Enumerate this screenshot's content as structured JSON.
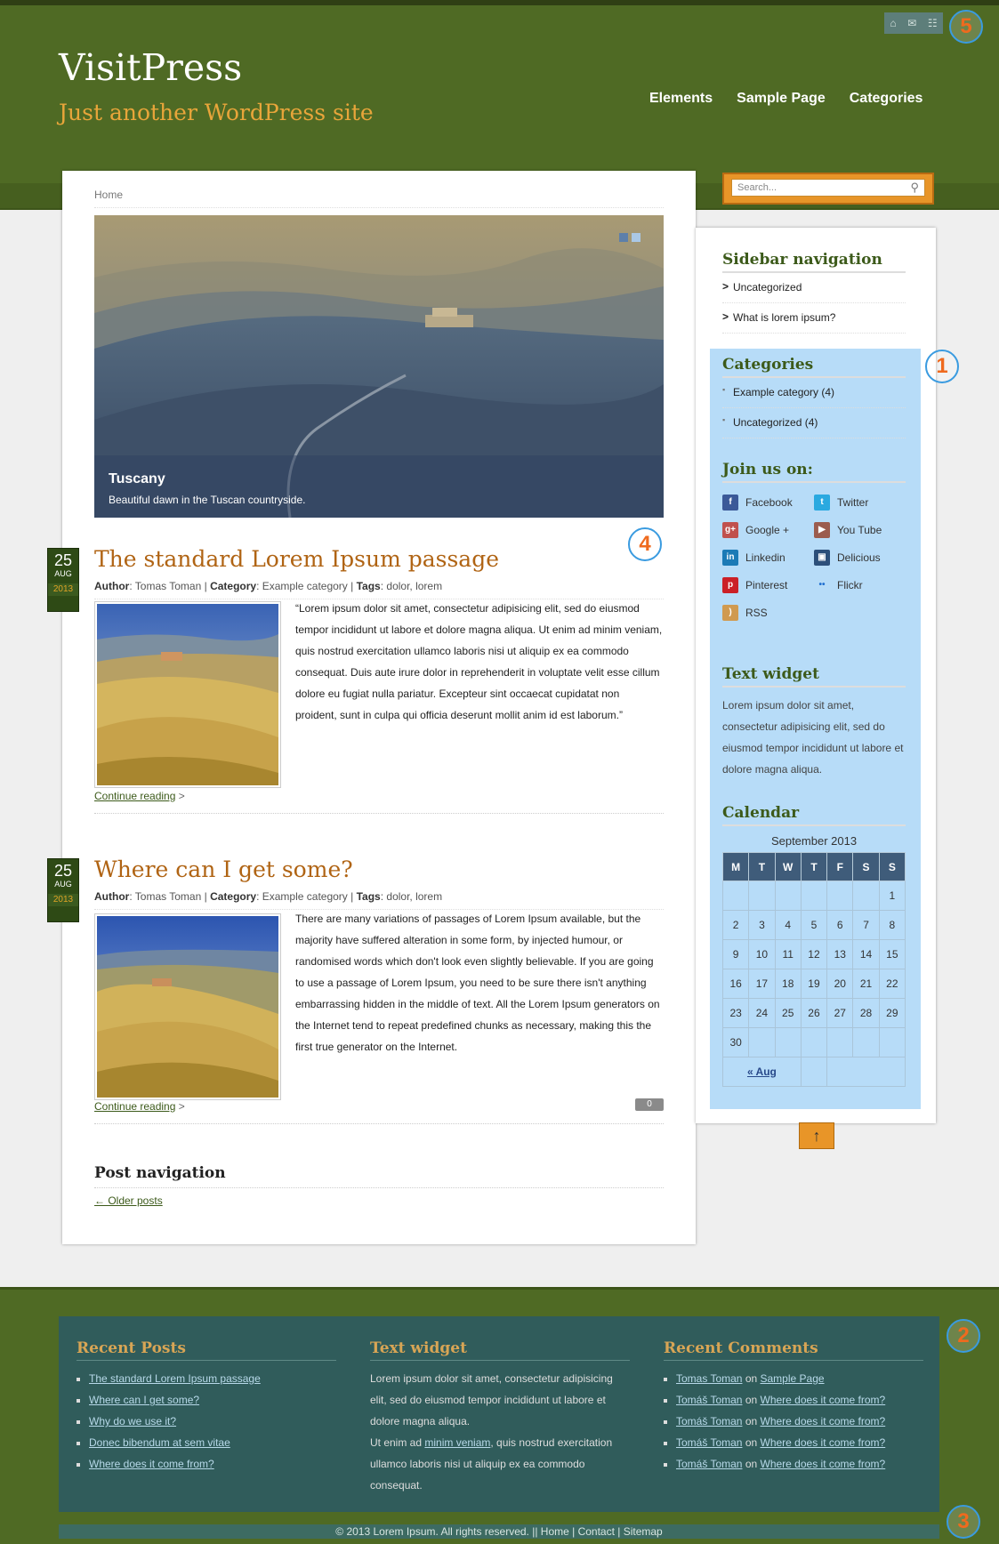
{
  "site": {
    "title": "VisitPress",
    "tagline": "Just another WordPress site"
  },
  "nav": {
    "items": [
      "Elements",
      "Sample Page",
      "Categories"
    ]
  },
  "top_icons": [
    "home-icon",
    "mail-icon",
    "sitemap-icon"
  ],
  "search": {
    "placeholder": "Search..."
  },
  "breadcrumb": "Home",
  "slider": {
    "title": "Tuscany",
    "caption": "Beautiful dawn in the Tuscan countryside."
  },
  "annotations": {
    "b1": "1",
    "b2": "2",
    "b3": "3",
    "b4": "4",
    "b5": "5"
  },
  "posts": [
    {
      "date": {
        "day": "25",
        "month": "AUG",
        "year": "2013"
      },
      "title": "The standard Lorem Ipsum passage",
      "author_label": "Author",
      "author": "Tomas Toman",
      "category_label": "Category",
      "category": "Example category",
      "tags_label": "Tags",
      "tag1": "dolor",
      "tag2": "lorem",
      "excerpt": "“Lorem ipsum dolor sit amet, consectetur adipisicing elit, sed do eiusmod tempor incididunt ut labore et dolore magna aliqua. Ut enim ad minim veniam, quis nostrud exercitation ullamco laboris nisi ut aliquip ex ea commodo consequat. Duis aute irure dolor in reprehenderit in voluptate velit esse cillum dolore eu fugiat nulla pariatur. Excepteur sint occaecat cupidatat non proident, sunt in culpa qui officia deserunt mollit anim id est laborum.”",
      "read_more": "Continue reading"
    },
    {
      "date": {
        "day": "25",
        "month": "AUG",
        "year": "2013"
      },
      "title": "Where can I get some?",
      "author_label": "Author",
      "author": "Tomas Toman",
      "category_label": "Category",
      "category": "Example category",
      "tags_label": "Tags",
      "tag1": "dolor",
      "tag2": "lorem",
      "excerpt": "There are many variations of passages of Lorem Ipsum available, but the majority have suffered alteration in some form, by injected humour, or randomised words which don't look even slightly believable. If you are going to use a passage of Lorem Ipsum, you need to be sure there isn't anything embarrassing hidden in the middle of text. All the Lorem Ipsum generators on the Internet tend to repeat predefined chunks as necessary, making this the first true generator on the Internet.",
      "read_more": "Continue reading",
      "comments": "0"
    }
  ],
  "post_nav": {
    "title": "Post navigation",
    "older": "← Older posts"
  },
  "sidebar": {
    "nav_title": "Sidebar navigation",
    "nav_items": [
      "Uncategorized",
      "What is lorem ipsum?"
    ],
    "categories_title": "Categories",
    "categories": [
      "Example category (4)",
      "Uncategorized (4)"
    ],
    "join_title": "Join us on:",
    "social": [
      {
        "label": "Facebook",
        "icon": "facebook-icon",
        "color": "#3b5998",
        "glyph": "f"
      },
      {
        "label": "Twitter",
        "icon": "twitter-icon",
        "color": "#2aa9e0",
        "glyph": "t"
      },
      {
        "label": "Google +",
        "icon": "google-plus-icon",
        "color": "#c0504d",
        "glyph": "g+"
      },
      {
        "label": "You Tube",
        "icon": "youtube-icon",
        "color": "#9b5c4e",
        "glyph": "▶"
      },
      {
        "label": "Linkedin",
        "icon": "linkedin-icon",
        "color": "#1b7ab6",
        "glyph": "in"
      },
      {
        "label": "Delicious",
        "icon": "delicious-icon",
        "color": "#2c4f7a",
        "glyph": "▣"
      },
      {
        "label": "Pinterest",
        "icon": "pinterest-icon",
        "color": "#cb2027",
        "glyph": "p"
      },
      {
        "label": "Flickr",
        "icon": "flickr-icon",
        "color": "#b7dcf8",
        "glyph": "••"
      },
      {
        "label": "RSS",
        "icon": "rss-icon",
        "color": "#d09a50",
        "glyph": ")"
      }
    ],
    "text_title": "Text widget",
    "text_body": "Lorem ipsum dolor sit amet, consectetur adipisicing elit, sed do eiusmod tempor incididunt ut labore et dolore magna aliqua.",
    "calendar_title": "Calendar",
    "calendar": {
      "caption": "September 2013",
      "headers": [
        "M",
        "T",
        "W",
        "T",
        "F",
        "S",
        "S"
      ],
      "weeks": [
        [
          "",
          "",
          "",
          "",
          "",
          "",
          "1"
        ],
        [
          "2",
          "3",
          "4",
          "5",
          "6",
          "7",
          "8"
        ],
        [
          "9",
          "10",
          "11",
          "12",
          "13",
          "14",
          "15"
        ],
        [
          "16",
          "17",
          "18",
          "19",
          "20",
          "21",
          "22"
        ],
        [
          "23",
          "24",
          "25",
          "26",
          "27",
          "28",
          "29"
        ],
        [
          "30",
          "",
          "",
          "",
          "",
          "",
          ""
        ]
      ],
      "prev": "« Aug"
    }
  },
  "to_top": "↑",
  "footer": {
    "recent_posts_title": "Recent Posts",
    "recent_posts": [
      "The standard Lorem Ipsum passage",
      "Where can I get some?",
      "Why do we use it?",
      "Donec bibendum at sem vitae",
      "Where does it come from?"
    ],
    "text_title": "Text widget",
    "text_p1": "Lorem ipsum dolor sit amet, consectetur adipisicing elit, sed do eiusmod tempor incididunt ut labore et dolore magna aliqua.",
    "text_p2_a": "Ut enim ad ",
    "text_p2_link": "minim veniam",
    "text_p2_b": ", quis nostrud exercitation ullamco laboris nisi ut aliquip ex ea commodo consequat.",
    "recent_comments_title": "Recent Comments",
    "recent_comments": [
      {
        "author": "Tomas Toman",
        "on": " on ",
        "post": "Sample Page"
      },
      {
        "author": "Tomáš Toman",
        "on": " on ",
        "post": "Where does it come from?"
      },
      {
        "author": "Tomáš Toman",
        "on": " on ",
        "post": "Where does it come from?"
      },
      {
        "author": "Tomáš Toman",
        "on": " on ",
        "post": "Where does it come from?"
      },
      {
        "author": "Tomáš Toman",
        "on": " on ",
        "post": "Where does it come from?"
      }
    ],
    "copyright": "© 2013 Lorem Ipsum. All rights reserved. || Home | Contact | Sitemap"
  }
}
